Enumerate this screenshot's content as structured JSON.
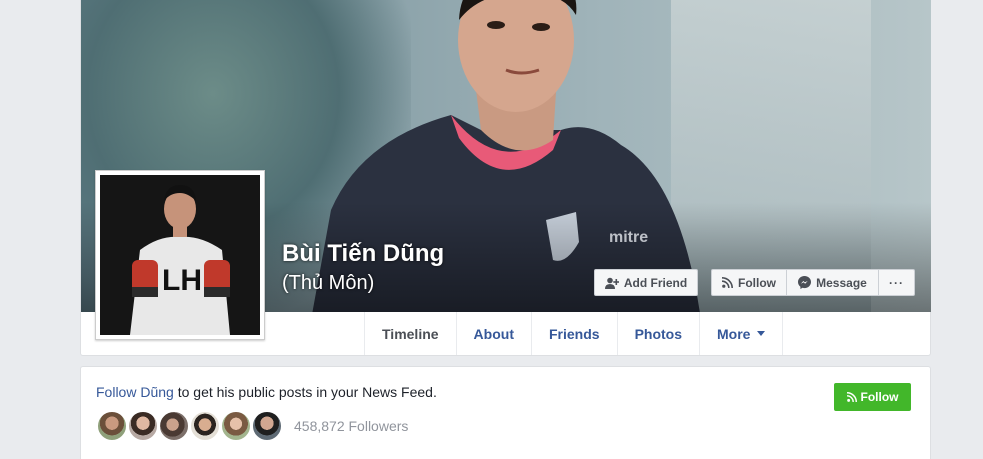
{
  "profile": {
    "name": "Bùi Tiến Dũng",
    "alternate_name": "(Thủ Môn)"
  },
  "actions": {
    "add_friend": "Add Friend",
    "follow": "Follow",
    "message": "Message",
    "more": "···"
  },
  "tabs": [
    {
      "label": "Timeline",
      "active": true
    },
    {
      "label": "About"
    },
    {
      "label": "Friends"
    },
    {
      "label": "Photos"
    },
    {
      "label": "More"
    }
  ],
  "follow_card": {
    "link_text": "Follow Dũng",
    "rest_text": " to get his public posts in your News Feed.",
    "button": "Follow",
    "followers_count": "458,872 Followers"
  },
  "colors": {
    "link": "#365899",
    "follow_green": "#42b72a",
    "page_bg": "#e9ebee"
  }
}
